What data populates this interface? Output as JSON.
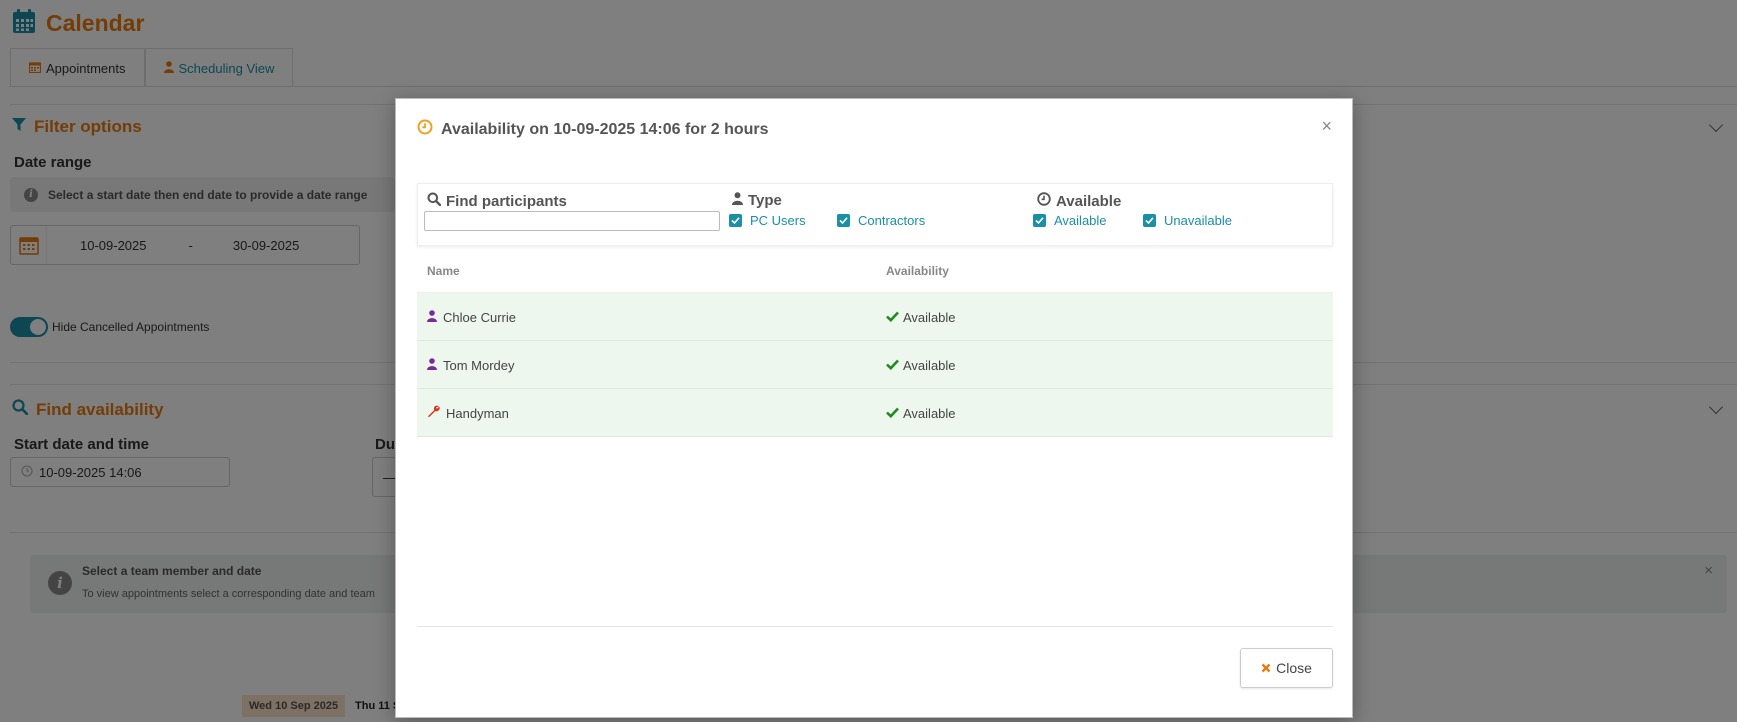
{
  "app": {
    "title": "Calendar"
  },
  "tabs": [
    {
      "label": "Appointments"
    },
    {
      "label": "Scheduling View"
    }
  ],
  "filter_options": {
    "title": "Filter options",
    "date_range_label": "Date range",
    "date_range_hint": "Select a start date then end date to provide a date range",
    "start_date": "10-09-2025",
    "separator": "-",
    "end_date": "30-09-2025",
    "hide_cancelled_label": "Hide Cancelled Appointments",
    "hide_cancelled_on": true
  },
  "find_availability": {
    "title": "Find availability",
    "start_label": "Start date and time",
    "start_value": "10-09-2025 14:06",
    "duration_label_partial": "Du",
    "duration_value_partial": "—"
  },
  "alert": {
    "title": "Select a team member and date",
    "body_partial": "To view appointments select a corresponding date and team",
    "close": "×"
  },
  "calendar_strip": {
    "day1": "Wed 10 Sep 2025",
    "day2_partial": "Thu 11 S"
  },
  "modal": {
    "title": "Availability on 10-09-2025 14:06 for 2 hours",
    "close_x": "×",
    "filters": {
      "find_label": "Find participants",
      "find_value": "",
      "type_label": "Type",
      "type_options": [
        "PC Users",
        "Contractors"
      ],
      "available_label": "Available",
      "available_options": [
        "Available",
        "Unavailable"
      ]
    },
    "columns": {
      "name": "Name",
      "availability": "Availability"
    },
    "rows": [
      {
        "name": "Chloe Currie",
        "type": "user",
        "availability": "Available"
      },
      {
        "name": "Tom Mordey",
        "type": "user",
        "availability": "Available"
      },
      {
        "name": "Handyman",
        "type": "contractor",
        "availability": "Available"
      }
    ],
    "close_button": "Close"
  },
  "colors": {
    "accent": "#e8790c",
    "teal": "#1b8fa6",
    "user_icon": "#7b2a9e",
    "contractor_icon": "#d9341c",
    "available_check": "#1e8c1e",
    "row_bg": "#eef7ee"
  },
  "icons": {
    "title": "calendar-icon",
    "find": "search-icon",
    "type": "user-icon",
    "available": "clock-icon",
    "user_row": "user-icon",
    "contractor_row": "wrench-icon",
    "status": "check-icon",
    "close": "times-icon"
  }
}
